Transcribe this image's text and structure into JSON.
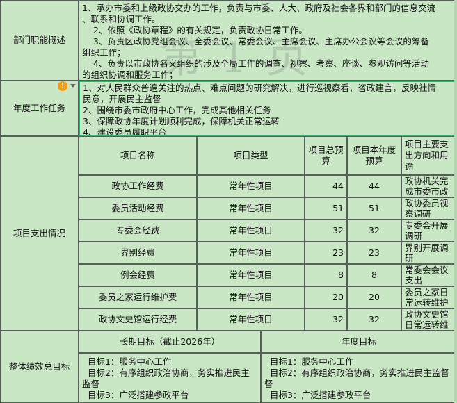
{
  "watermark": "第 1 页",
  "dept": {
    "label": "部门职能概述",
    "lines": [
      "1、承办市委和上级政协交办的工作，负责与市委、人大、政府及社会各界和部门的信息交流",
      "、联系和协调工作。",
      "    2、依照《政协章程》的有关规定，负责政协日常工作。",
      "    3、负责区政协党组会议、全委会议、常委会议、主席会议、主席办公会议等会议的筹备",
      "组织工作；",
      "    4、负责以市政协名义组织的涉及全局工作的调查、视察、考察、座谈、参观访问等活动",
      "的组织协调和服务工作；"
    ]
  },
  "annual": {
    "label": "年度工作任务",
    "lines": [
      "1、对人民群众普遍关注的热点、难点问题的研究解决，进行巡视察看，咨政建言，反映社情",
      "民意，开展民主监督",
      "2、围绕市委市政府中心工作，完成其他相关任务",
      "3、保障政协年度计划顺利完成，保障机关正常运转",
      "4、建设委员履职平台"
    ],
    "warning_icon": "warning-icon"
  },
  "projects": {
    "label": "项目支出情况",
    "headers": {
      "name": "项目名称",
      "type": "项目类型",
      "total": [
        "项目总预",
        "算"
      ],
      "year": [
        "项目本年度",
        "预算"
      ],
      "purpose": [
        "项目主要支",
        "出方向和用",
        "途"
      ]
    },
    "rows": [
      {
        "name": "政协工作经费",
        "type": "常年性项目",
        "total": "44",
        "year": "44",
        "purpose": [
          "政协机关完",
          "成市委市政"
        ]
      },
      {
        "name": "委员活动经费",
        "type": "常年性项目",
        "total": "51",
        "year": "51",
        "purpose": [
          "政协委员视",
          "察调研"
        ]
      },
      {
        "name": "专委会经费",
        "type": "常年性项目",
        "total": "32",
        "year": "32",
        "purpose": [
          "专委会开展",
          "调研"
        ]
      },
      {
        "name": "界别经费",
        "type": "常年性项目",
        "total": "23",
        "year": "23",
        "purpose": [
          "界别开展调",
          "研"
        ]
      },
      {
        "name": "例会经费",
        "type": "常年性项目",
        "total": "8",
        "year": "8",
        "purpose": [
          "常委会会议",
          "支出"
        ]
      },
      {
        "name": "委员之家运行维护费",
        "type": "常年性项目",
        "total": "20",
        "year": "20",
        "purpose": [
          "委员之家日",
          "常运转维护"
        ]
      },
      {
        "name": "政协文史馆运行经费",
        "type": "常年性项目",
        "total": "32",
        "year": "32",
        "purpose": [
          "政协文史馆",
          "日常运转维"
        ]
      }
    ]
  },
  "perf": {
    "label": "整体绩效总目标",
    "long_header": "长期目标（截止2026年）",
    "year_header": "年度目标",
    "long_lines": [
      "  目标1：服务中心工作",
      "  目标2：有序组织政治协商，务实推进民主",
      "监督",
      "  目标3：广泛搭建参政平台"
    ],
    "year_lines": [
      "  目标1：服务中心工作",
      "  目标2：有序组织政治协商，务实推进民主监督",
      "督",
      "  目标3：广泛搭建参政平台"
    ]
  }
}
